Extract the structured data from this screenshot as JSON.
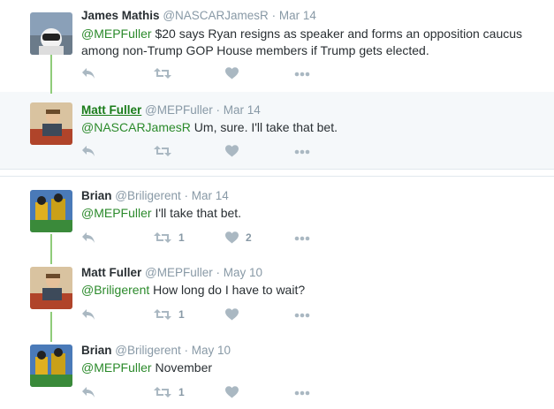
{
  "tweets": [
    {
      "name": "James Mathis",
      "handle": "@NASCARJamesR",
      "sep": "·",
      "time": "Mar 14",
      "mention": "@MEPFuller",
      "text": " $20 says Ryan resigns as speaker and forms an opposition caucus among non-Trump GOP House members if Trump gets elected.",
      "retweets": "",
      "likes": ""
    },
    {
      "name": "Matt Fuller",
      "handle": "@MEPFuller",
      "sep": "·",
      "time": "Mar 14",
      "mention": "@NASCARJamesR",
      "text": " Um, sure. I'll take that bet.",
      "retweets": "",
      "likes": ""
    },
    {
      "name": "Brian",
      "handle": "@Briligerent",
      "sep": "·",
      "time": "Mar 14",
      "mention": "@MEPFuller",
      "text": " I'll take that bet.",
      "retweets": "1",
      "likes": "2"
    },
    {
      "name": "Matt Fuller",
      "handle": "@MEPFuller",
      "sep": "·",
      "time": "May 10",
      "mention": "@Briligerent",
      "text": " How long do I have to wait?",
      "retweets": "1",
      "likes": ""
    },
    {
      "name": "Brian",
      "handle": "@Briligerent",
      "sep": "·",
      "time": "May 10",
      "mention": "@MEPFuller",
      "text": " November",
      "retweets": "1",
      "likes": ""
    }
  ],
  "colors": {
    "mention": "#2b8a2b",
    "thread_line": "#8fcc7a",
    "meta": "#8899a6",
    "icon": "#aab8c2"
  },
  "icons": [
    "reply-icon",
    "retweet-icon",
    "like-icon",
    "more-icon"
  ]
}
